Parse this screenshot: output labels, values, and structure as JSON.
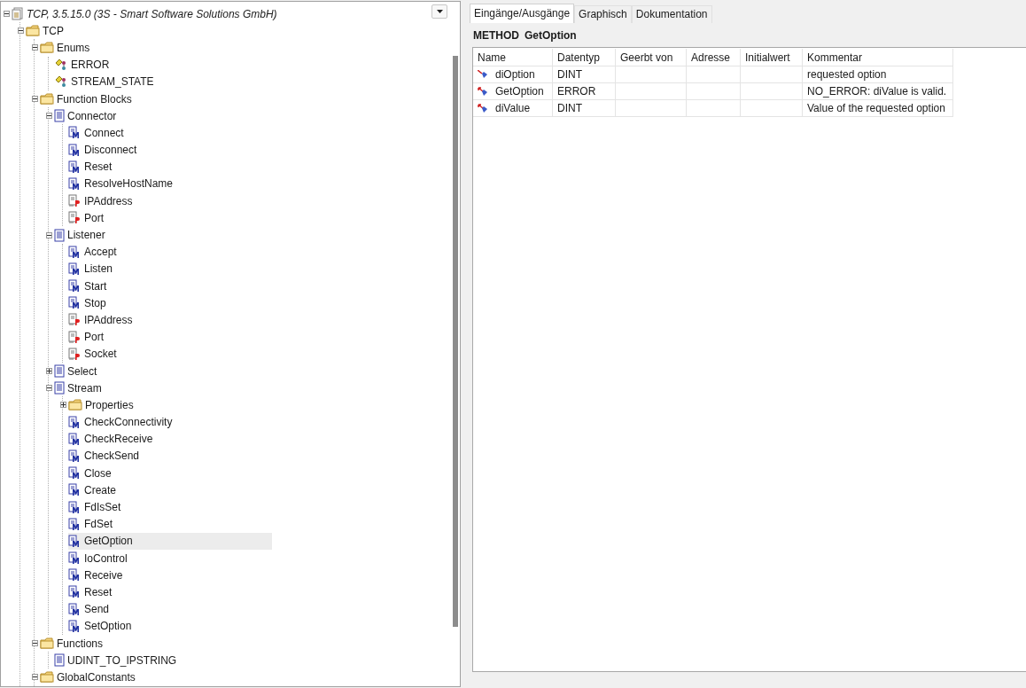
{
  "tree": [
    {
      "label": "TCP, 3.5.15.0 (3S - Smart Software Solutions GmbH)",
      "kind": "library",
      "expanded": true,
      "selected": false,
      "children": [
        {
          "label": "TCP",
          "kind": "folder",
          "expanded": true,
          "selected": false,
          "children": [
            {
              "label": "Enums",
              "kind": "folder",
              "expanded": true,
              "selected": false,
              "children": [
                {
                  "label": "ERROR",
                  "kind": "enum",
                  "selected": false
                },
                {
                  "label": "STREAM_STATE",
                  "kind": "enum",
                  "selected": false
                }
              ]
            },
            {
              "label": "Function Blocks",
              "kind": "folder",
              "expanded": true,
              "selected": false,
              "children": [
                {
                  "label": "Connector",
                  "kind": "block",
                  "expanded": true,
                  "selected": false,
                  "children": [
                    {
                      "label": "Connect",
                      "kind": "method",
                      "selected": false
                    },
                    {
                      "label": "Disconnect",
                      "kind": "method",
                      "selected": false
                    },
                    {
                      "label": "Reset",
                      "kind": "method",
                      "selected": false
                    },
                    {
                      "label": "ResolveHostName",
                      "kind": "method",
                      "selected": false
                    },
                    {
                      "label": "IPAddress",
                      "kind": "property",
                      "selected": false
                    },
                    {
                      "label": "Port",
                      "kind": "property",
                      "selected": false
                    }
                  ]
                },
                {
                  "label": "Listener",
                  "kind": "block",
                  "expanded": true,
                  "selected": false,
                  "children": [
                    {
                      "label": "Accept",
                      "kind": "method",
                      "selected": false
                    },
                    {
                      "label": "Listen",
                      "kind": "method",
                      "selected": false
                    },
                    {
                      "label": "Start",
                      "kind": "method",
                      "selected": false
                    },
                    {
                      "label": "Stop",
                      "kind": "method",
                      "selected": false
                    },
                    {
                      "label": "IPAddress",
                      "kind": "property",
                      "selected": false
                    },
                    {
                      "label": "Port",
                      "kind": "property",
                      "selected": false
                    },
                    {
                      "label": "Socket",
                      "kind": "property",
                      "selected": false
                    }
                  ]
                },
                {
                  "label": "Select",
                  "kind": "block",
                  "expanded": false,
                  "selected": false
                },
                {
                  "label": "Stream",
                  "kind": "block",
                  "expanded": true,
                  "selected": false,
                  "children": [
                    {
                      "label": "Properties",
                      "kind": "folder",
                      "expanded": false,
                      "selected": false
                    },
                    {
                      "label": "CheckConnectivity",
                      "kind": "method",
                      "selected": false
                    },
                    {
                      "label": "CheckReceive",
                      "kind": "method",
                      "selected": false
                    },
                    {
                      "label": "CheckSend",
                      "kind": "method",
                      "selected": false
                    },
                    {
                      "label": "Close",
                      "kind": "method",
                      "selected": false
                    },
                    {
                      "label": "Create",
                      "kind": "method",
                      "selected": false
                    },
                    {
                      "label": "FdIsSet",
                      "kind": "method",
                      "selected": false
                    },
                    {
                      "label": "FdSet",
                      "kind": "method",
                      "selected": false
                    },
                    {
                      "label": "GetOption",
                      "kind": "method",
                      "selected": true
                    },
                    {
                      "label": "IoControl",
                      "kind": "method",
                      "selected": false
                    },
                    {
                      "label": "Receive",
                      "kind": "method",
                      "selected": false
                    },
                    {
                      "label": "Reset",
                      "kind": "method",
                      "selected": false
                    },
                    {
                      "label": "Send",
                      "kind": "method",
                      "selected": false
                    },
                    {
                      "label": "SetOption",
                      "kind": "method",
                      "selected": false
                    }
                  ]
                }
              ]
            },
            {
              "label": "Functions",
              "kind": "folder",
              "expanded": true,
              "selected": false,
              "children": [
                {
                  "label": "UDINT_TO_IPSTRING",
                  "kind": "block",
                  "selected": false
                }
              ]
            },
            {
              "label": "GlobalConstants",
              "kind": "folder",
              "expanded": true,
              "selected": false
            }
          ]
        }
      ]
    }
  ],
  "tabs": [
    {
      "label": "Eingänge/Ausgänge",
      "selected": true
    },
    {
      "label": "Graphisch",
      "selected": false
    },
    {
      "label": "Dokumentation",
      "selected": false
    }
  ],
  "method": {
    "keyword": "METHOD",
    "name": "GetOption"
  },
  "table": {
    "columns": [
      "Name",
      "Datentyp",
      "Geerbt von",
      "Adresse",
      "Initialwert",
      "Kommentar"
    ],
    "rows": [
      {
        "kind": "input",
        "name": "diOption",
        "type": "DINT",
        "comment": "requested option"
      },
      {
        "kind": "output",
        "name": "GetOption",
        "type": "ERROR",
        "comment": "NO_ERROR: diValue is valid."
      },
      {
        "kind": "output",
        "name": "diValue",
        "type": "DINT",
        "comment": "Value of the requested option"
      }
    ]
  }
}
